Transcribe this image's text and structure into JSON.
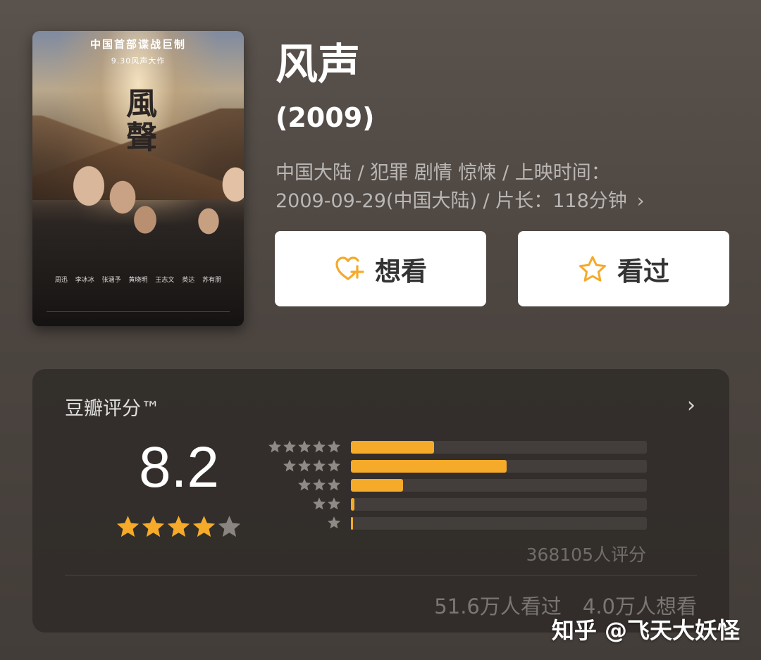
{
  "poster": {
    "headline": "中国首部谍战巨制",
    "subline": "9.30风声大作",
    "calligraphy": "風聲",
    "cast": "周迅 李冰冰 张涵予 黄晓明 王志文 英达 苏有朋"
  },
  "movie": {
    "title": "风声",
    "year": "(2009)",
    "meta_line1": "中国大陆 / 犯罪 剧情 惊悚 / 上映时间：",
    "meta_line2": "2009-09-29(中国大陆) / 片长：118分钟",
    "meta_arrow": "›"
  },
  "actions": {
    "want_label": "想看",
    "seen_label": "看过",
    "want_icon": "heart-plus-icon",
    "seen_icon": "star-outline-icon",
    "accent": "#f5aa2a"
  },
  "rating": {
    "title": "豆瓣评分™",
    "arrow": "›",
    "score": "8.2",
    "stars_filled": 4,
    "stars_total": 5,
    "distribution": [
      {
        "stars": 5,
        "fraction": 0.28
      },
      {
        "stars": 4,
        "fraction": 0.525
      },
      {
        "stars": 3,
        "fraction": 0.175
      },
      {
        "stars": 2,
        "fraction": 0.012
      },
      {
        "stars": 1,
        "fraction": 0.005
      }
    ],
    "votes": "368105人评分",
    "seen_count": "51.6万人看过",
    "want_count": "4.0万人想看"
  },
  "watermark": "知乎 @飞天大妖怪",
  "colors": {
    "star_on": "#f5aa2a",
    "star_off": "#8a8580",
    "dist_star": "#8f8a85"
  }
}
